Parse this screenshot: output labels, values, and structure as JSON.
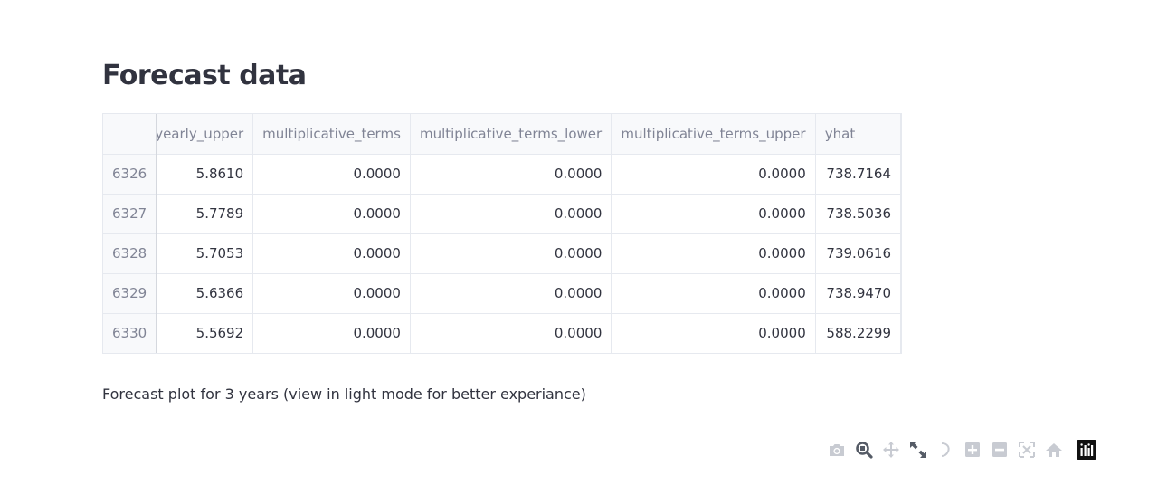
{
  "heading": "Forecast data",
  "table": {
    "columns": [
      "",
      "yearly_upper",
      "multiplicative_terms",
      "multiplicative_terms_lower",
      "multiplicative_terms_upper",
      "yhat"
    ],
    "rows": [
      [
        "6326",
        "5.8610",
        "0.0000",
        "0.0000",
        "0.0000",
        "738.7164"
      ],
      [
        "6327",
        "5.7789",
        "0.0000",
        "0.0000",
        "0.0000",
        "738.5036"
      ],
      [
        "6328",
        "5.7053",
        "0.0000",
        "0.0000",
        "0.0000",
        "739.0616"
      ],
      [
        "6329",
        "5.6366",
        "0.0000",
        "0.0000",
        "0.0000",
        "738.9470"
      ],
      [
        "6330",
        "5.5692",
        "0.0000",
        "0.0000",
        "0.0000",
        "588.2299"
      ]
    ]
  },
  "caption": "Forecast plot for 3 years (view in light mode for better experiance)",
  "modebar": {
    "icons": [
      "camera-icon",
      "zoom-icon",
      "pan-icon",
      "autoscale-icon",
      "lasso-icon",
      "zoom-in-icon",
      "zoom-out-icon",
      "reset-axes-icon",
      "home-icon",
      "plotly-logo-icon"
    ],
    "active": "zoom-icon"
  },
  "colors": {
    "text": "#31333f",
    "muted": "#808495",
    "border": "#e6e9ef",
    "header_bg": "#f8f9fb",
    "icon": "#c8cbd2",
    "icon_active": "#555b66"
  }
}
